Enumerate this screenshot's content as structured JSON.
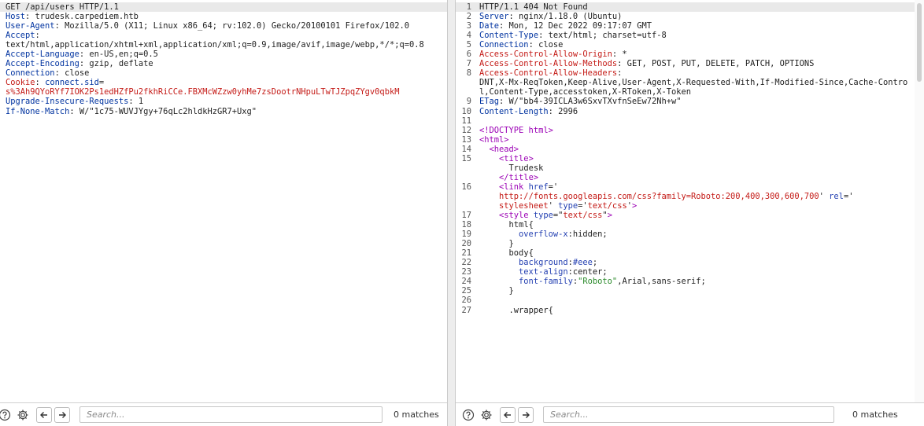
{
  "request": {
    "lines": [
      [
        {
          "t": "GET /api/users HTTP/1.1",
          "c": ""
        }
      ],
      [
        {
          "t": "Host",
          "c": "hk"
        },
        {
          "t": ": trudesk.carpediem.htb",
          "c": ""
        }
      ],
      [
        {
          "t": "User-Agent",
          "c": "hk"
        },
        {
          "t": ": Mozilla/5.0 (X11; Linux x86_64; rv:102.0) Gecko/20100101 Firefox/102.0",
          "c": ""
        }
      ],
      [
        {
          "t": "Accept",
          "c": "hk"
        },
        {
          "t": ":\ntext/html,application/xhtml+xml,application/xml;q=0.9,image/avif,image/webp,*/*;q=0.8",
          "c": ""
        }
      ],
      [
        {
          "t": "Accept-Language",
          "c": "hk"
        },
        {
          "t": ": en-US,en;q=0.5",
          "c": ""
        }
      ],
      [
        {
          "t": "Accept-Encoding",
          "c": "hk"
        },
        {
          "t": ": gzip, deflate",
          "c": ""
        }
      ],
      [
        {
          "t": "Connection",
          "c": "hk"
        },
        {
          "t": ": close",
          "c": ""
        }
      ],
      [
        {
          "t": "Cookie",
          "c": "red"
        },
        {
          "t": ": ",
          "c": ""
        },
        {
          "t": "connect.sid",
          "c": "hk"
        },
        {
          "t": "=\n",
          "c": ""
        },
        {
          "t": "s%3Ah9QYoRYf7IOK2Ps1edHZfPu2fkhRiCCe.FBXMcWZzw0yhMe7zsDootrNHpuLTwTJZpqZYgv0qbkM",
          "c": "red"
        }
      ],
      [
        {
          "t": "Upgrade-Insecure-Requests",
          "c": "hk"
        },
        {
          "t": ": 1",
          "c": ""
        }
      ],
      [
        {
          "t": "If-None-Match",
          "c": "hk"
        },
        {
          "t": ": W/\"1c75-WUVJYgy+76qLc2hldkHzGR7+Uxg\"",
          "c": ""
        }
      ]
    ]
  },
  "response": {
    "lines": [
      {
        "n": "1",
        "s": [
          {
            "t": "HTTP/1.1 404 Not Found",
            "c": ""
          }
        ]
      },
      {
        "n": "2",
        "s": [
          {
            "t": "Server",
            "c": "hk"
          },
          {
            "t": ": nginx/1.18.0 (Ubuntu)",
            "c": ""
          }
        ]
      },
      {
        "n": "3",
        "s": [
          {
            "t": "Date",
            "c": "hk"
          },
          {
            "t": ": Mon, 12 Dec 2022 09:17:07 GMT",
            "c": ""
          }
        ]
      },
      {
        "n": "4",
        "s": [
          {
            "t": "Content-Type",
            "c": "hk"
          },
          {
            "t": ": text/html; charset=utf-8",
            "c": ""
          }
        ]
      },
      {
        "n": "5",
        "s": [
          {
            "t": "Connection",
            "c": "hk"
          },
          {
            "t": ": close",
            "c": ""
          }
        ]
      },
      {
        "n": "6",
        "s": [
          {
            "t": "Access-Control-Allow-Origin",
            "c": "red"
          },
          {
            "t": ": *",
            "c": ""
          }
        ]
      },
      {
        "n": "7",
        "s": [
          {
            "t": "Access-Control-Allow-Methods",
            "c": "red"
          },
          {
            "t": ": GET, POST, PUT, DELETE, PATCH, OPTIONS",
            "c": ""
          }
        ]
      },
      {
        "n": "8",
        "s": [
          {
            "t": "Access-Control-Allow-Headers",
            "c": "red"
          },
          {
            "t": ":",
            "c": ""
          }
        ]
      },
      {
        "n": "",
        "s": [
          {
            "t": "DNT,X-Mx-ReqToken,Keep-Alive,User-Agent,X-Requested-With,If-Modified-Since,Cache-Control,Content-Type,accesstoken,X-RToken,X-Token",
            "c": ""
          }
        ]
      },
      {
        "n": "9",
        "s": [
          {
            "t": "ETag",
            "c": "hk"
          },
          {
            "t": ": W/\"bb4-39ICLA3w6SxvTXvfnSeEw72Nh+w\"",
            "c": ""
          }
        ]
      },
      {
        "n": "10",
        "s": [
          {
            "t": "Content-Length",
            "c": "hk"
          },
          {
            "t": ": 2996",
            "c": ""
          }
        ]
      },
      {
        "n": "11",
        "s": [
          {
            "t": "",
            "c": ""
          }
        ]
      },
      {
        "n": "12",
        "s": [
          {
            "t": "<!DOCTYPE html>",
            "c": "tag"
          }
        ]
      },
      {
        "n": "13",
        "s": [
          {
            "t": "<html>",
            "c": "tag"
          }
        ]
      },
      {
        "n": "14",
        "s": [
          {
            "t": "  ",
            "c": ""
          },
          {
            "t": "<head>",
            "c": "tag"
          }
        ]
      },
      {
        "n": "15",
        "s": [
          {
            "t": "    ",
            "c": ""
          },
          {
            "t": "<title>",
            "c": "tag"
          }
        ]
      },
      {
        "n": "",
        "s": [
          {
            "t": "      Trudesk",
            "c": ""
          }
        ]
      },
      {
        "n": "",
        "s": [
          {
            "t": "    ",
            "c": ""
          },
          {
            "t": "</title>",
            "c": "tag"
          }
        ]
      },
      {
        "n": "16",
        "s": [
          {
            "t": "    ",
            "c": ""
          },
          {
            "t": "<link ",
            "c": "tag"
          },
          {
            "t": "href",
            "c": "attr"
          },
          {
            "t": "='",
            "c": ""
          }
        ]
      },
      {
        "n": "",
        "s": [
          {
            "t": "    http://fonts.googleapis.com/css?family=Roboto:200,400,300,600,700",
            "c": "str"
          },
          {
            "t": "' ",
            "c": ""
          },
          {
            "t": "rel",
            "c": "attr"
          },
          {
            "t": "='",
            "c": ""
          }
        ]
      },
      {
        "n": "",
        "s": [
          {
            "t": "    stylesheet",
            "c": "str"
          },
          {
            "t": "' ",
            "c": ""
          },
          {
            "t": "type",
            "c": "attr"
          },
          {
            "t": "='",
            "c": ""
          },
          {
            "t": "text/css",
            "c": "str"
          },
          {
            "t": "'",
            "c": ""
          },
          {
            "t": ">",
            "c": "tag"
          }
        ]
      },
      {
        "n": "17",
        "s": [
          {
            "t": "    ",
            "c": ""
          },
          {
            "t": "<style ",
            "c": "tag"
          },
          {
            "t": "type",
            "c": "attr"
          },
          {
            "t": "=\"",
            "c": ""
          },
          {
            "t": "text/css",
            "c": "str"
          },
          {
            "t": "\"",
            "c": ""
          },
          {
            "t": ">",
            "c": "tag"
          }
        ]
      },
      {
        "n": "18",
        "s": [
          {
            "t": "      html{",
            "c": "css-sel"
          }
        ]
      },
      {
        "n": "19",
        "s": [
          {
            "t": "        ",
            "c": ""
          },
          {
            "t": "overflow-x",
            "c": "css-prop"
          },
          {
            "t": ":hidden;",
            "c": ""
          }
        ]
      },
      {
        "n": "20",
        "s": [
          {
            "t": "      }",
            "c": ""
          }
        ]
      },
      {
        "n": "21",
        "s": [
          {
            "t": "      body{",
            "c": "css-sel"
          }
        ]
      },
      {
        "n": "22",
        "s": [
          {
            "t": "        ",
            "c": ""
          },
          {
            "t": "background",
            "c": "css-prop"
          },
          {
            "t": ":",
            "c": ""
          },
          {
            "t": "#eee",
            "c": "css-hex"
          },
          {
            "t": ";",
            "c": ""
          }
        ]
      },
      {
        "n": "23",
        "s": [
          {
            "t": "        ",
            "c": ""
          },
          {
            "t": "text-align",
            "c": "css-prop"
          },
          {
            "t": ":center;",
            "c": ""
          }
        ]
      },
      {
        "n": "24",
        "s": [
          {
            "t": "        ",
            "c": ""
          },
          {
            "t": "font-family",
            "c": "css-prop"
          },
          {
            "t": ":",
            "c": ""
          },
          {
            "t": "\"Roboto\"",
            "c": "css-val"
          },
          {
            "t": ",Arial,sans-serif;",
            "c": ""
          }
        ]
      },
      {
        "n": "25",
        "s": [
          {
            "t": "      }",
            "c": ""
          }
        ]
      },
      {
        "n": "26",
        "s": [
          {
            "t": "",
            "c": ""
          }
        ]
      },
      {
        "n": "27",
        "s": [
          {
            "t": "      .wrapper{",
            "c": "css-sel"
          }
        ]
      }
    ]
  },
  "searchbars": {
    "left": {
      "placeholder": "Search...",
      "value": "",
      "matches": "0 matches"
    },
    "right": {
      "placeholder": "Search...",
      "value": "",
      "matches": "0 matches"
    }
  },
  "icons": {
    "help": "help-icon",
    "settings": "settings-icon",
    "prev": "arrow-left-icon",
    "next": "arrow-right-icon"
  }
}
